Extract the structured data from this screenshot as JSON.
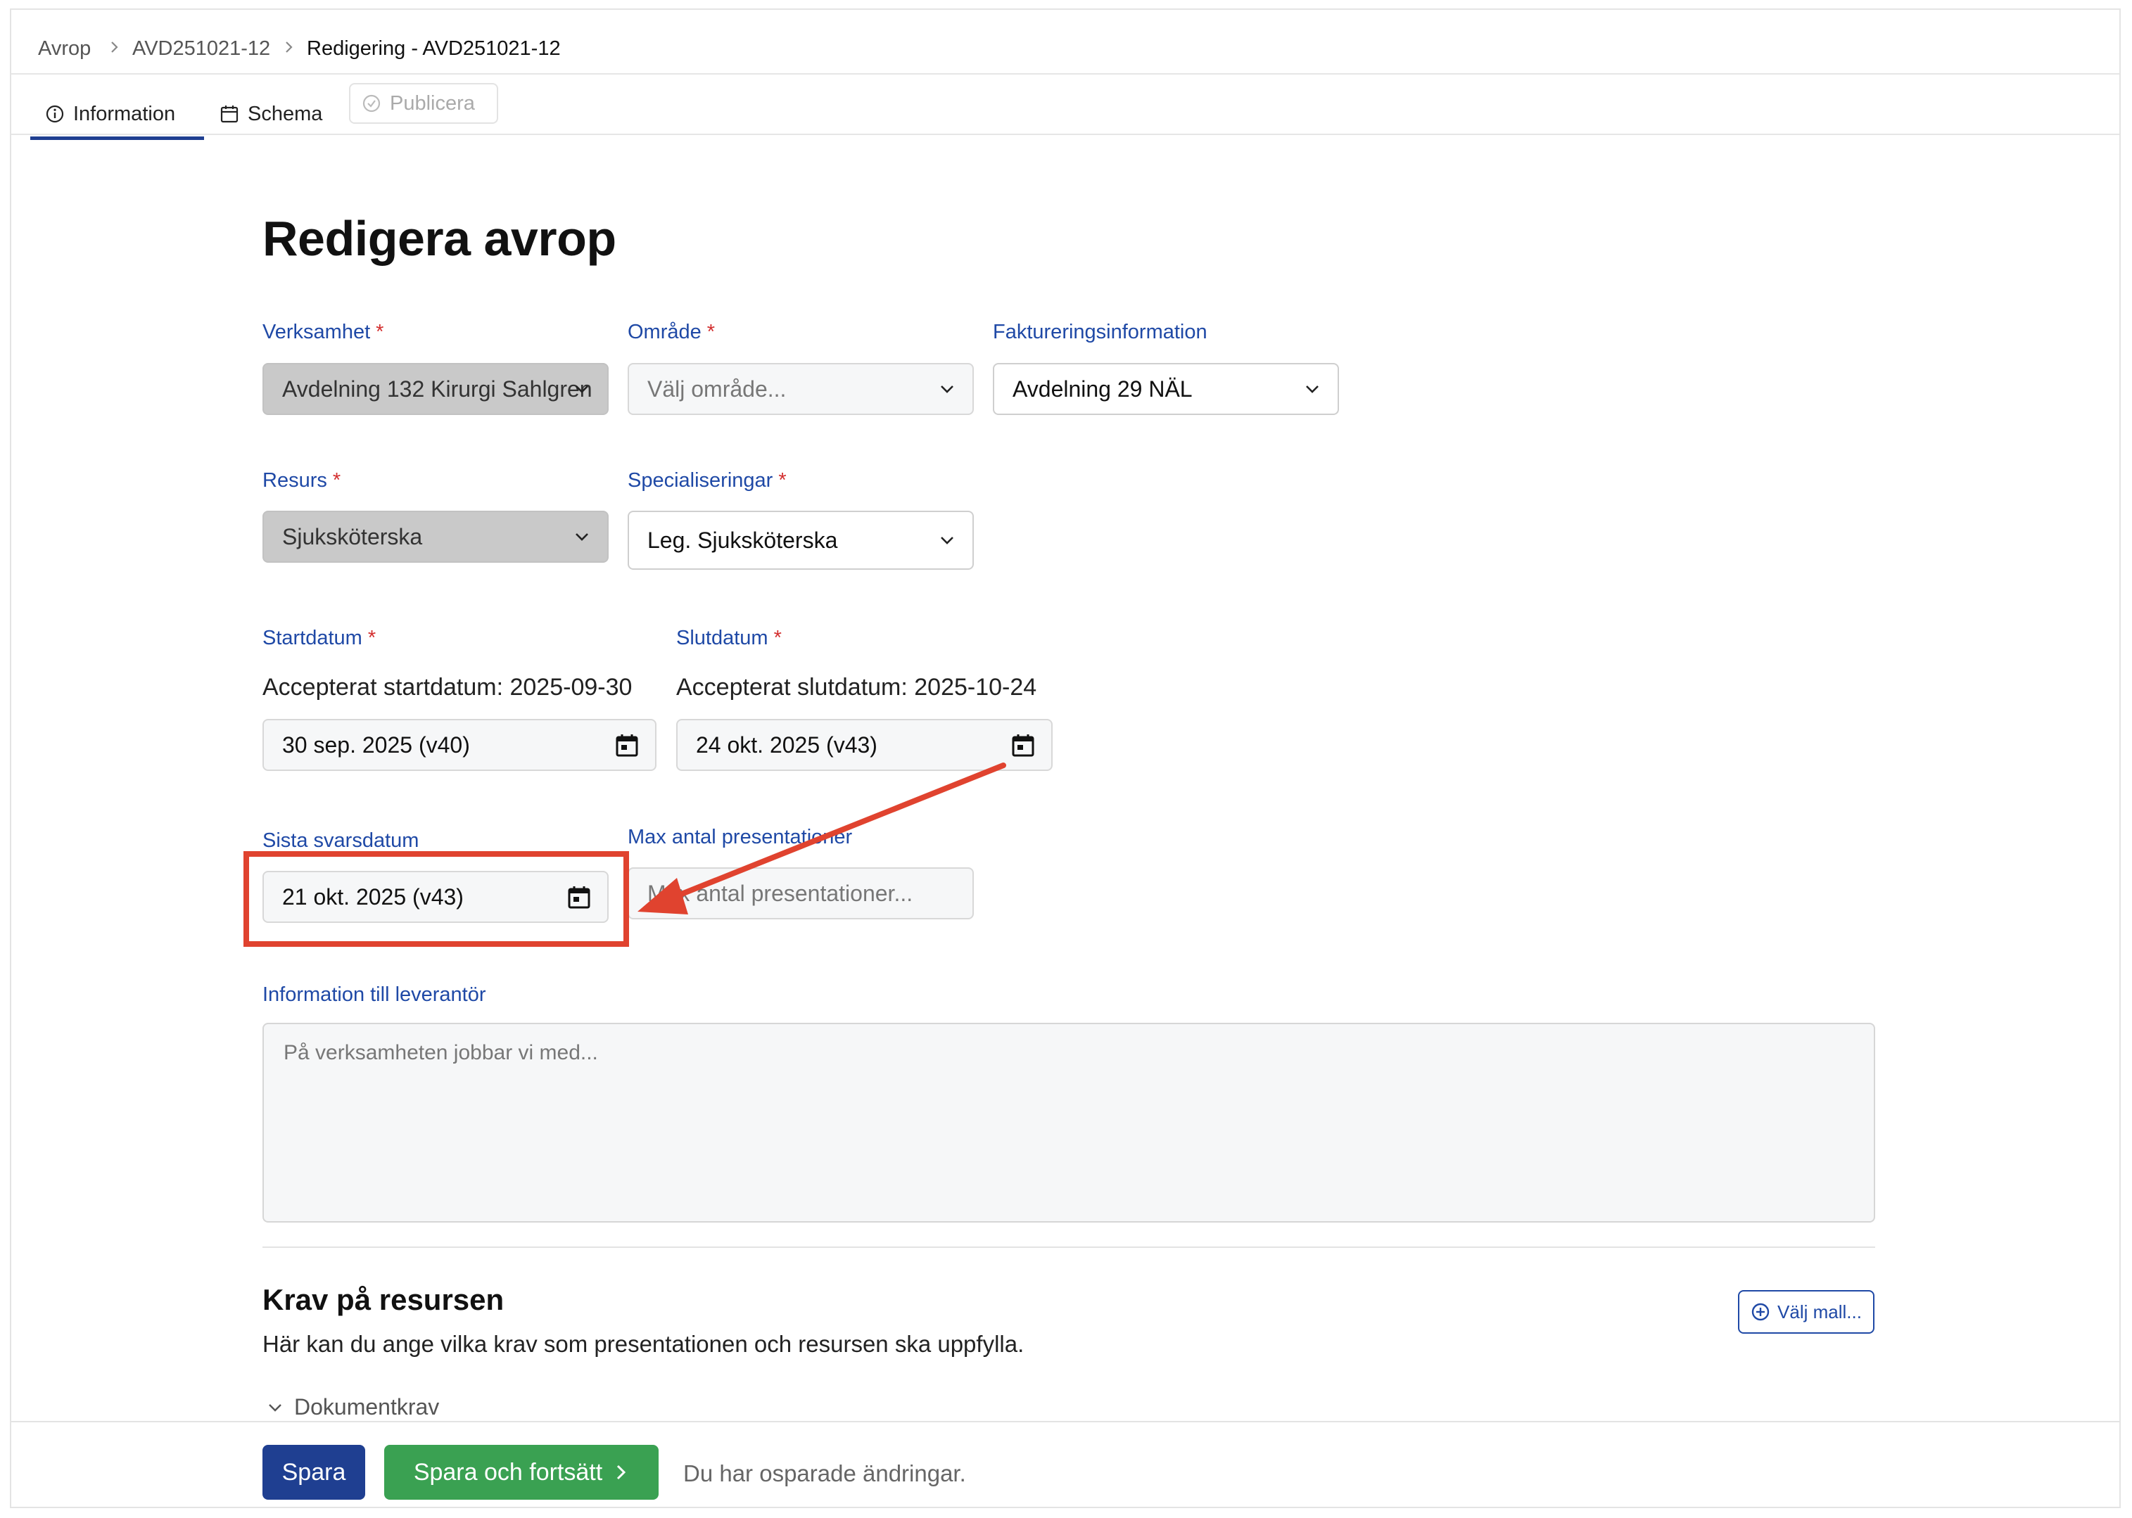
{
  "breadcrumb": {
    "items": [
      "Avrop",
      "AVD251021-12"
    ],
    "current": "Redigering - AVD251021-12"
  },
  "tabs": {
    "information": "Information",
    "schema": "Schema",
    "publicera": "Publicera"
  },
  "page": {
    "title": "Redigera avrop"
  },
  "form": {
    "verksamhet": {
      "label": "Verksamhet",
      "value": "Avdelning 132 Kirurgi Sahlgren"
    },
    "omrade": {
      "label": "Område",
      "placeholder": "Välj område..."
    },
    "fakturering": {
      "label": "Faktureringsinformation",
      "value": "Avdelning 29 NÄL"
    },
    "resurs": {
      "label": "Resurs",
      "value": "Sjuksköterska"
    },
    "specialiseringar": {
      "label": "Specialiseringar",
      "value": "Leg. Sjuksköterska"
    },
    "startdatum": {
      "label": "Startdatum",
      "accepted": "Accepterat startdatum: 2025-09-30",
      "value": "30 sep. 2025 (v40)"
    },
    "slutdatum": {
      "label": "Slutdatum",
      "accepted": "Accepterat slutdatum: 2025-10-24",
      "value": "24 okt. 2025 (v43)"
    },
    "sista_svarsdatum": {
      "label": "Sista svarsdatum",
      "value": "21 okt. 2025 (v43)"
    },
    "max_presentationer": {
      "label": "Max antal presentationer",
      "placeholder": "Max antal presentationer..."
    },
    "information_leverantor": {
      "label": "Information till leverantör",
      "placeholder": "På verksamheten jobbar vi med..."
    },
    "required_marker": "*"
  },
  "krav": {
    "title": "Krav på resursen",
    "description": "Här kan du ange vilka krav som presentationen och resursen ska uppfylla.",
    "template_button": "Välj mall...",
    "accordion": "Dokumentkrav"
  },
  "footer": {
    "save": "Spara",
    "save_continue": "Spara och fortsätt",
    "status": "Du har osparade ändringar."
  },
  "colors": {
    "primary": "#1f3f91",
    "label": "#1f49a6",
    "success": "#3aa152",
    "required": "#d32f2f",
    "annotation": "#e0432f"
  },
  "icons": [
    "info-icon",
    "calendar-icon",
    "check-circle-icon",
    "chevron-down-icon",
    "chevron-right-icon",
    "plus-circle-icon",
    "arrow-annotation"
  ]
}
